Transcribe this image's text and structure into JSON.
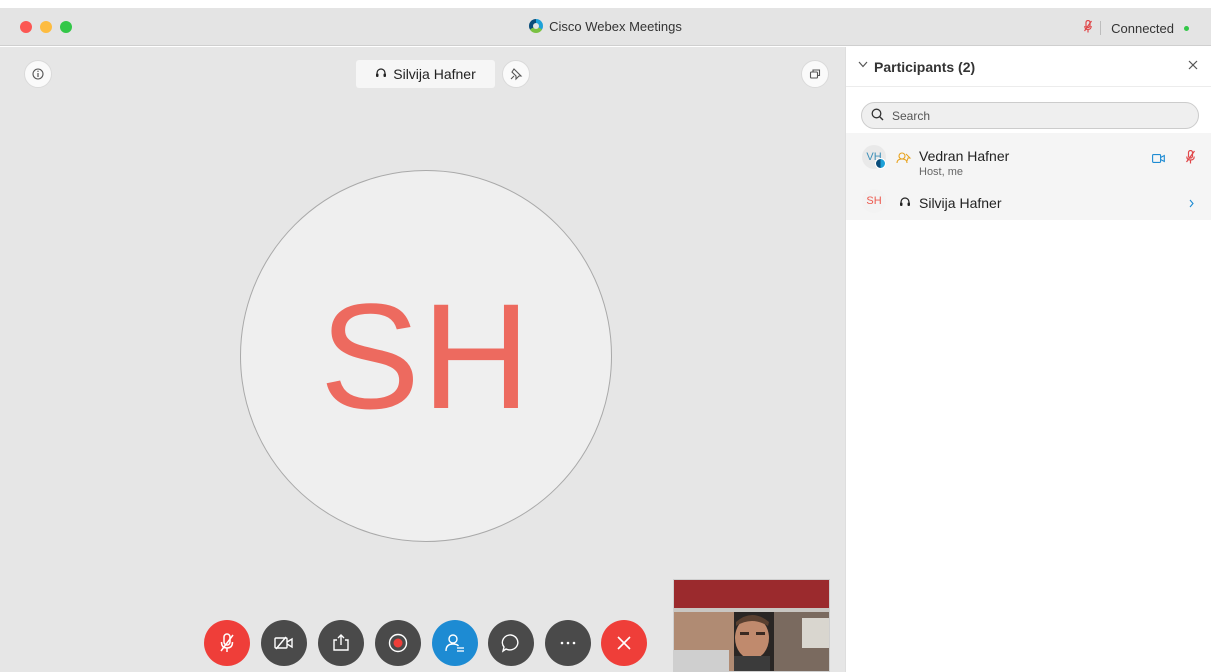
{
  "window": {
    "app_title": "Cisco Webex Meetings",
    "connection_status": "Connected"
  },
  "stage": {
    "active_speaker": "Silvija Hafner",
    "speaker_initials": "SH"
  },
  "participants_panel": {
    "title": "Participants (2)",
    "search_placeholder": "Search",
    "participants": [
      {
        "initials": "VH",
        "name": "Vedran Hafner",
        "role": "Host, me"
      },
      {
        "initials": "SH",
        "name": "Silvija Hafner"
      }
    ]
  },
  "toolbar": {
    "buttons": [
      "mute",
      "stop-video",
      "share",
      "record",
      "participants",
      "chat",
      "more",
      "leave"
    ]
  },
  "colors": {
    "accent_red": "#ef3e39",
    "accent_blue": "#1d8bd3",
    "avatar_initials": "#ed6a5f"
  }
}
